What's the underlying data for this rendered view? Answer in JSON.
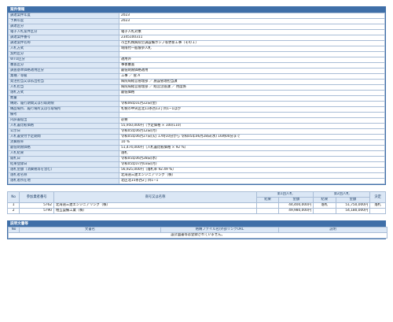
{
  "section1": {
    "title": "案件情報",
    "rows": [
      {
        "label": "調達案件年度",
        "value": "2023"
      },
      {
        "label": "予算年度",
        "value": "2023"
      },
      {
        "label": "調達区分",
        "value": ""
      },
      {
        "label": "電子入札案件区分",
        "value": "電子入札対象"
      },
      {
        "label": "調達案件番号",
        "value": "2345100311"
      },
      {
        "label": "調達案件名称",
        "value": "市立札幌病院空調設備ポンプ等更新工事（その１）"
      },
      {
        "label": "入札方式",
        "value": "制限付一般競争入札"
      },
      {
        "label": "契約区分",
        "value": ""
      },
      {
        "label": "WTO区分",
        "value": "適用外"
      },
      {
        "label": "審査区分",
        "value": "事後審査"
      },
      {
        "label": "調査基準価格適用区分",
        "value": "最低制限価格適用"
      },
      {
        "label": "業種／等級",
        "value": "工事 ／ 管 A"
      },
      {
        "label": "発注担当又は払出担当",
        "value": "病院局経営管理部 ／ 施設管理担当課"
      },
      {
        "label": "入札担当",
        "value": "病院局経営管理部 ／ 経営企画課 ／ 用度係"
      },
      {
        "label": "落札方式",
        "value": "最低価格"
      },
      {
        "label": "数量",
        "value": ""
      },
      {
        "label": "納期、履行期間又は引取期限",
        "value": "令和06年01月22日(金)"
      },
      {
        "label": "納品場所、履行場所又は引取場所",
        "value": "札幌市中央区北11条西13丁目1−1ほか"
      },
      {
        "label": "備考",
        "value": ""
      },
      {
        "label": "内訳書提出",
        "value": "必要"
      },
      {
        "label": "入札書比較価格",
        "value": "55,950,000円（予定価格 × 100/110）"
      },
      {
        "label": "公示日",
        "value": "令和05年06月12日(月)"
      },
      {
        "label": "入札書受付予定期間",
        "value": "令和05年06月27日(火) 17時10分から 令和05年06月28日(水) 16時00分まで"
      },
      {
        "label": "消費税率",
        "value": "10 %"
      },
      {
        "label": "最低制限価格",
        "value": "51,474,000円（入札書比較価格 × 92 %）"
      },
      {
        "label": "入札結果",
        "value": "落札"
      },
      {
        "label": "開札日",
        "value": "令和05年06月28日(水)"
      },
      {
        "label": "結果登録日",
        "value": "令和05年07月03日(月)"
      },
      {
        "label": "落札金額（消費税等を含む）",
        "value": "56,925,000円（落札率 92.49 %）"
      },
      {
        "label": "落札者名称",
        "value": "北海道三建エンジニアリング（株）"
      },
      {
        "label": "落札者所在地",
        "value": "北区北15条西2丁目1−1"
      }
    ]
  },
  "bids": {
    "headers": {
      "no": "No",
      "reg_no": "参加業者番号",
      "name": "商号又は名称",
      "round1": "第1回入札",
      "round2": "第2回入札",
      "decision": "決定",
      "result": "結果",
      "amount": "金額"
    },
    "rows": [
      {
        "no": "1",
        "reg": "5762",
        "name": "北海道三建エンジニアリング（株）",
        "r1_result": "",
        "r1_amount": "44,400,000円",
        "r2_result": "落札",
        "r2_amount": "51,750,000円",
        "decision": "落札"
      },
      {
        "no": "2",
        "reg": "5790",
        "name": "相互設備工業（株）",
        "r1_result": "",
        "r1_amount": "49,980,000円",
        "r2_result": "",
        "r2_amount": "54,180,000円",
        "decision": ""
      }
    ]
  },
  "docs": {
    "title": "説明文書等",
    "headers": {
      "no": "No",
      "doc_name": "文書名",
      "file": "格納ファイル名/外部リンクURL",
      "desc": "説明"
    },
    "empty_message": "設計図書等は登録されていません。"
  }
}
